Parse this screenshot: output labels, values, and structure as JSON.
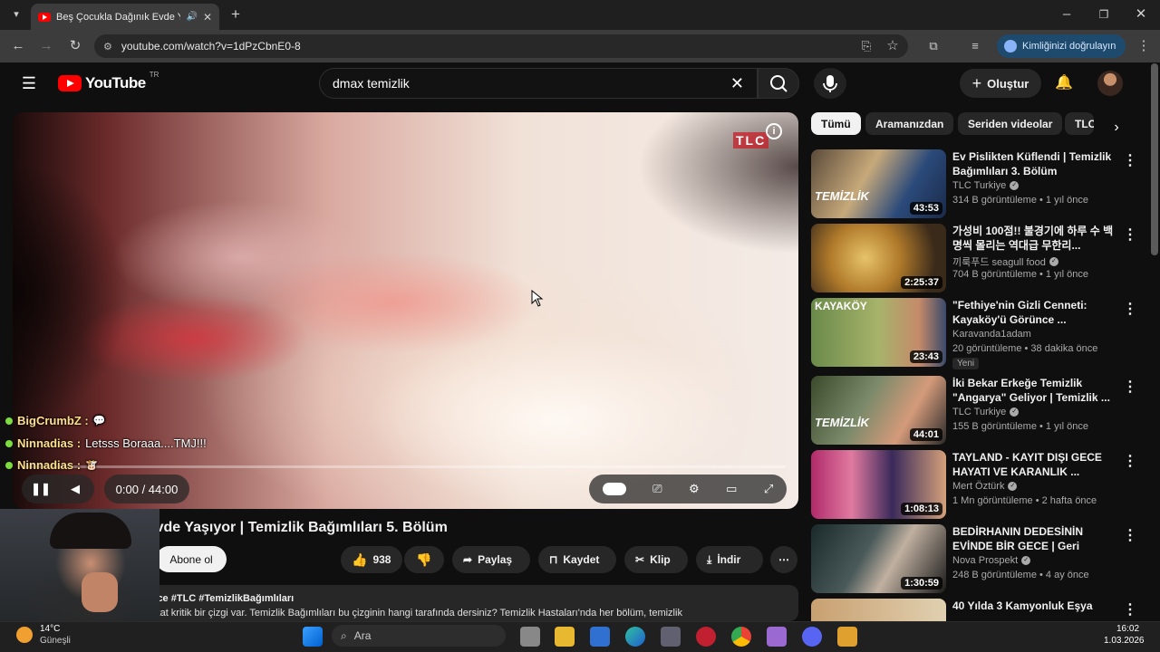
{
  "browser": {
    "tab_title": "Beş Çocukla Dağınık Evde Y",
    "url": "youtube.com/watch?v=1dPzCbnE0-8",
    "verify_label": "Kimliğinizi doğrulayın"
  },
  "youtube": {
    "logo_text": "YouTube",
    "country": "TR",
    "search_query": "dmax temizlik",
    "create_label": "Oluştur"
  },
  "player": {
    "watermark": "TLC",
    "time": "0:00 / 44:00",
    "progress": 0
  },
  "chat": [
    {
      "user": "BigCrumbZ :",
      "message": ""
    },
    {
      "user": "Ninnadias :",
      "message": "Letsss Boraaa....TMJ!!!"
    },
    {
      "user": "Ninnadias :",
      "message": ""
    }
  ],
  "video": {
    "title": "...ğ... Evde Yaşıyor | Temizlik Bağımlıları 5. Bölüm",
    "subscribe": "Abone ol",
    "likes": "938",
    "share": "Paylaş",
    "save": "Kaydet",
    "clip": "Klip",
    "download": "İndir",
    "desc_meta": "önce  #TLC #TemizlikBağımlıları",
    "desc_body": "...k ile takıntı arasında ince fakat kritik bir çizgi var. Temizlik Bağımlıları bu çizginin hangi tarafında dersiniz? Temizlik Hastaları'nda her bölüm, temizlik"
  },
  "chips": [
    "Tümü",
    "Aramanızdan",
    "Seriden videolar",
    "TLC"
  ],
  "recommendations": [
    {
      "title": "Ev Pislikten Küflendi | Temizlik Bağımlıları 3. Bölüm",
      "channel": "TLC Turkiye",
      "verified": true,
      "views": "314 B görüntüleme • 1 yıl önce",
      "duration": "43:53",
      "badge": ""
    },
    {
      "title": "가성비 100점!! 불경기에 하루 수 백명씩 몰리는 역대급 무한리...",
      "channel": "끼룩푸드 seagull food",
      "verified": true,
      "views": "704 B görüntüleme • 1 yıl önce",
      "duration": "2:25:37",
      "badge": ""
    },
    {
      "title": "\"Fethiye'nin Gizli Cenneti: Kayaköy'ü Görünce ...",
      "channel": "Karavanda1adam",
      "verified": false,
      "views": "20 görüntüleme • 38 dakika önce",
      "duration": "23:43",
      "badge": "Yeni"
    },
    {
      "title": "İki Bekar Erkeğe Temizlik \"Angarya\" Geliyor | Temizlik ...",
      "channel": "TLC Turkiye",
      "verified": true,
      "views": "155 B görüntüleme • 1 yıl önce",
      "duration": "44:01",
      "badge": ""
    },
    {
      "title": "TAYLAND - KAYIT DIŞI GECE HAYATI VE KARANLIK ...",
      "channel": "Mert Öztürk",
      "verified": true,
      "views": "1 Mn görüntüleme • 2 hafta önce",
      "duration": "1:08:13",
      "badge": ""
    },
    {
      "title": "BEDİRHANIN DEDESİNİN EVİNDE BİR GECE | Geri Dönüş...",
      "channel": "Nova Prospekt",
      "verified": true,
      "views": "248 B görüntüleme • 4 ay önce",
      "duration": "1:30:59",
      "badge": ""
    },
    {
      "title": "40 Yılda 3 Kamyonluk Eşya",
      "channel": "",
      "verified": false,
      "views": "",
      "duration": "",
      "badge": ""
    }
  ],
  "thumb_labels": [
    "TEMİZLİK",
    "",
    "KAYAKÖY",
    "TEMİZLİK",
    "",
    "",
    ""
  ],
  "taskbar": {
    "temp": "14°C",
    "weather": "Güneşli",
    "search_placeholder": "Ara",
    "time": "16:02",
    "date": "1.03.2026"
  }
}
